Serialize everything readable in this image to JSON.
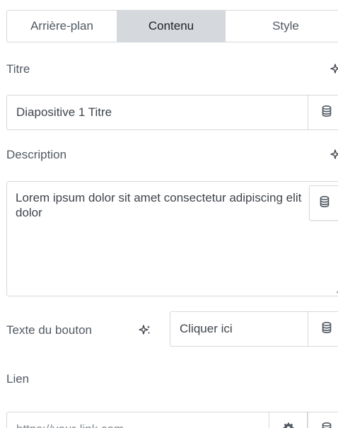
{
  "tabs": [
    {
      "label": "Arrière-plan",
      "active": false
    },
    {
      "label": "Contenu",
      "active": true
    },
    {
      "label": "Style",
      "active": false
    }
  ],
  "fields": {
    "title": {
      "label": "Titre",
      "value": "Diapositive 1 Titre"
    },
    "description": {
      "label": "Description",
      "value": "Lorem ipsum dolor sit amet consectetur adipiscing elit dolor"
    },
    "button_text": {
      "label": "Texte du bouton",
      "value": "Cliquer ici"
    },
    "link": {
      "label": "Lien",
      "placeholder": "https://your-link.com"
    }
  },
  "icons": {
    "ai": "ai-sparkle-icon",
    "dynamic": "database-icon",
    "link_options": "gear-icon"
  },
  "colors": {
    "active_tab_bg": "#d5d8dc",
    "border": "#d5d8dc",
    "text": "#3f444b"
  }
}
